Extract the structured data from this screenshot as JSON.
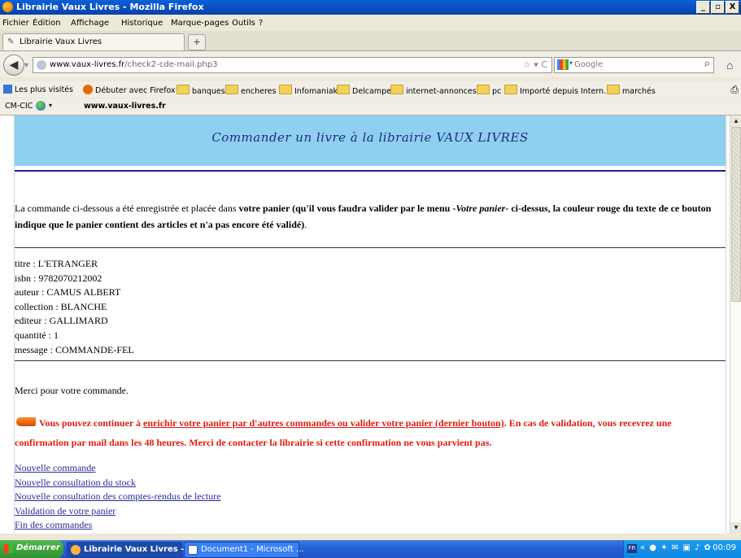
{
  "window": {
    "title": "Librairie Vaux Livres - Mozilla Firefox",
    "buttons": [
      "_",
      "▫",
      "X"
    ]
  },
  "menu": [
    "Fichier",
    "Édition",
    "Affichage",
    "Historique",
    "Marque-pages",
    "Outils",
    "?"
  ],
  "tab": {
    "label": "Librairie Vaux Livres",
    "new_tab": "+"
  },
  "nav": {
    "url_domain": "www.vaux-livres.fr",
    "url_path": "/check2-cde-mail.php3",
    "url_scheme": "http://",
    "search_placeholder": "Google"
  },
  "bookmarks": [
    "Les plus visités",
    "Débuter avec Firefox",
    "banques",
    "encheres",
    "Infomaniak",
    "Delcampe",
    "internet-annonces",
    "pc",
    "Importé depuis Intern...",
    "marchés"
  ],
  "cmbar": {
    "label": "CM-CIC",
    "site": "www.vaux-livres.fr"
  },
  "page": {
    "banner_title": "Commander un livre à la librairie VAUX LIVRES",
    "intro_part1": "La commande ci-dessous a été enregistrée et placée dans ",
    "intro_part2": "votre panier (qu'il vous faudra valider par le menu -",
    "intro_part3": "Votre panier",
    "intro_part4": "- ci-dessus, la couleur rouge du texte de ce bouton indique que le panier contient des articles et n'a pas encore été validé)",
    "intro_part5": ".",
    "details": [
      "titre : L'ETRANGER",
      "isbn : 9782070212002",
      "auteur : CAMUS ALBERT",
      "collection : BLANCHE",
      "editeur : GALLIMARD",
      "quantité : 1",
      "message : COMMANDE-FEL"
    ],
    "thanks": "Merci pour votre commande.",
    "notice_part1": "Vous pouvez continuer à ",
    "notice_link": "enrichir votre panier par d'autres commandes ou valider votre panier (dernier bouton)",
    "notice_part2": ". En cas de validation, vous recevrez une confirmation par mail dans les 48 heures. Merci de contacter la librairie si cette confirmation ne vous parvient pas.",
    "links": [
      "Nouvelle commande",
      "Nouvelle consultation du stock",
      "Nouvelle consultation des comptes-rendus de lecture",
      "Validation de votre panier",
      "Fin des commandes"
    ]
  },
  "taskbar": {
    "start": "Démarrer",
    "tasks": [
      "Librairie Vaux Livres -...",
      "Document1 - Microsoft ..."
    ],
    "lang": "FR",
    "clock": "00:09"
  }
}
